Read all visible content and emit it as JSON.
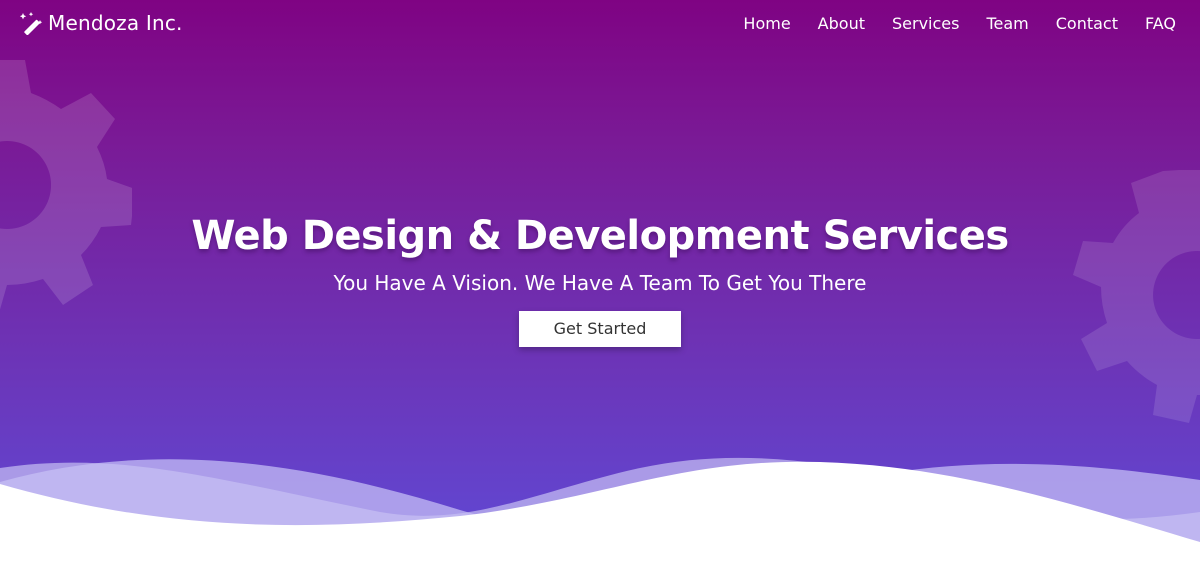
{
  "brand": {
    "name": "Mendoza Inc.",
    "icon": "magic-wand-icon"
  },
  "nav": {
    "items": [
      {
        "label": "Home"
      },
      {
        "label": "About"
      },
      {
        "label": "Services"
      },
      {
        "label": "Team"
      },
      {
        "label": "Contact"
      },
      {
        "label": "FAQ"
      }
    ]
  },
  "hero": {
    "title": "Web Design & Development Services",
    "subtitle": "You Have A Vision. We Have A Team To Get You There",
    "cta_label": "Get Started"
  },
  "colors": {
    "gradient_top": "#7f0383",
    "gradient_bottom": "#5f4ad6",
    "wave_light": "#b9aef0",
    "text": "#ffffff",
    "button_text": "#333333"
  },
  "decorations": {
    "left_icon": "gear-icon",
    "right_icon": "gear-icon",
    "bottom": "wave-shape"
  }
}
